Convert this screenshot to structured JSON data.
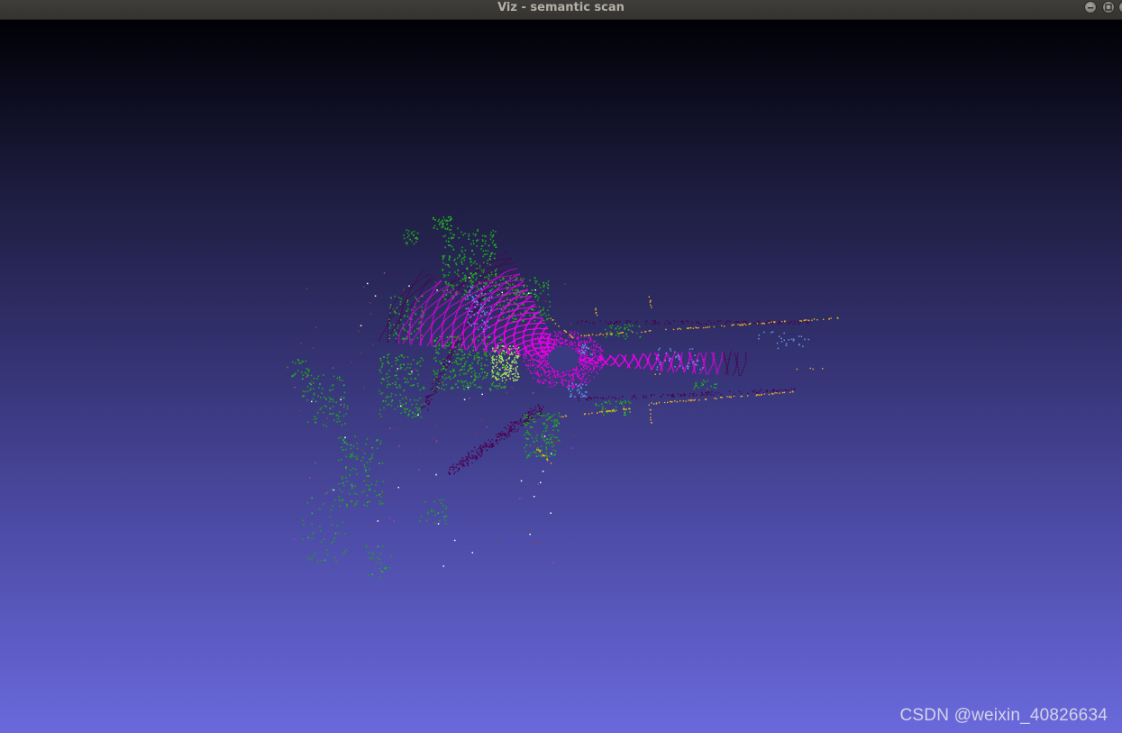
{
  "window": {
    "title": "Viz - semantic scan",
    "controls": {
      "minimize_icon": "minimize-icon",
      "maximize_icon": "maximize-icon",
      "close_icon": "close-icon"
    }
  },
  "viewport": {
    "background_top": "#000006",
    "background_bottom": "#6a69dc"
  },
  "watermark": {
    "text": "CSDN @weixin_40826634"
  },
  "legend_colors": {
    "road": "#e800e8",
    "sidewalk": "#4b0050",
    "vegetation": "#1ea01e",
    "terrain": "#a8e060",
    "pole": "#f0b020",
    "car": "#6495ed",
    "other": "#8b3a3a"
  }
}
